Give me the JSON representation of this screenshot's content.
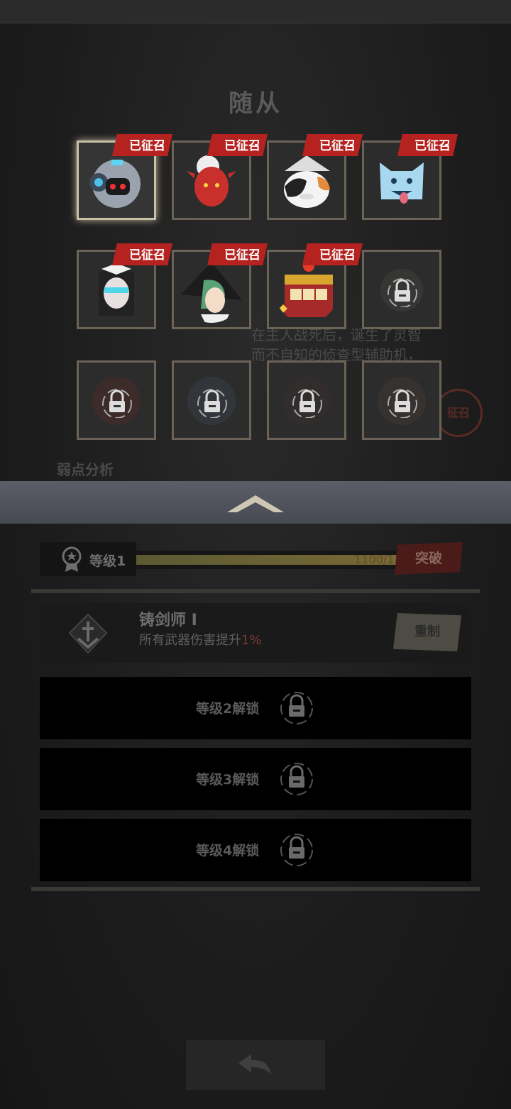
{
  "screen": {
    "title": "随从",
    "summoned_badge": "已征召"
  },
  "companions": [
    {
      "name": "robot",
      "status": "summoned",
      "selected": true
    },
    {
      "name": "red-demon-girl",
      "status": "summoned"
    },
    {
      "name": "calico-cat",
      "status": "summoned"
    },
    {
      "name": "ice-spirit",
      "status": "summoned"
    },
    {
      "name": "masked-maid",
      "status": "summoned"
    },
    {
      "name": "green-haired-witch",
      "status": "summoned"
    },
    {
      "name": "slot-machine",
      "status": "summoned"
    },
    {
      "name": "locked-1",
      "status": "locked"
    },
    {
      "name": "locked-2",
      "status": "locked"
    },
    {
      "name": "locked-3",
      "status": "locked"
    },
    {
      "name": "locked-4",
      "status": "locked"
    },
    {
      "name": "locked-5",
      "status": "locked"
    }
  ],
  "background_detail": {
    "lines": [
      "在主人战死后，诞生了灵智",
      "而不自知的侦查型辅助机，"
    ],
    "section": "弱点分析",
    "stamp": "征召"
  },
  "level": {
    "label": "等级1",
    "progress_text": "1100/1100",
    "progress_fraction": 1.0,
    "break_label": "突破"
  },
  "skill": {
    "name": "铸剑师 I",
    "desc_prefix": "所有武器伤害提升",
    "desc_value": "1%",
    "reset_label": "重制"
  },
  "unlocks": [
    {
      "label": "等级2解锁"
    },
    {
      "label": "等级3解锁"
    },
    {
      "label": "等级4解锁"
    }
  ],
  "colors": {
    "badge": "#b5221f",
    "break_button": "#4a1b19",
    "selected_border": "#c9c0a8"
  }
}
